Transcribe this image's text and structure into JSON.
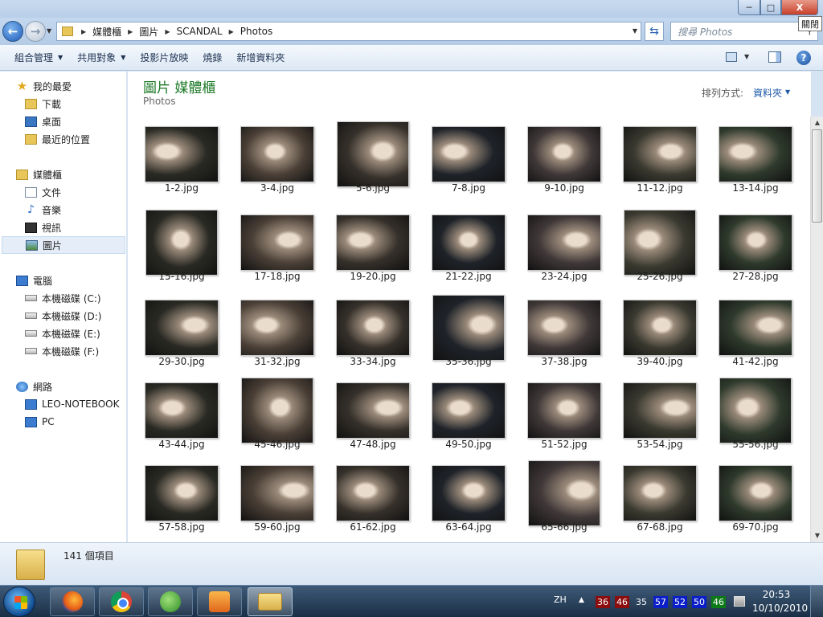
{
  "window": {
    "close_tooltip": "關閉",
    "caption": {
      "minimize": "─",
      "maximize": "□",
      "close": "X"
    }
  },
  "address": {
    "crumbs": [
      "媒體櫃",
      "圖片",
      "SCANDAL",
      "Photos"
    ],
    "search_placeholder": "搜尋 Photos"
  },
  "toolbar": {
    "organize": "組合管理",
    "share_with": "共用對象",
    "slideshow": "投影片放映",
    "burn": "燒錄",
    "new_folder": "新增資料夾"
  },
  "navpane": {
    "favorites": {
      "label": "我的最愛",
      "items": [
        {
          "label": "下載",
          "icon": "download-folder-icon"
        },
        {
          "label": "桌面",
          "icon": "desktop-icon"
        },
        {
          "label": "最近的位置",
          "icon": "recent-places-icon"
        }
      ]
    },
    "libraries": {
      "label": "媒體櫃",
      "items": [
        {
          "label": "文件",
          "icon": "documents-icon"
        },
        {
          "label": "音樂",
          "icon": "music-icon"
        },
        {
          "label": "視訊",
          "icon": "video-icon"
        },
        {
          "label": "圖片",
          "icon": "pictures-icon",
          "selected": true
        }
      ]
    },
    "computer": {
      "label": "電腦",
      "items": [
        {
          "label": "本機磁碟 (C:)",
          "icon": "drive-icon"
        },
        {
          "label": "本機磁碟 (D:)",
          "icon": "drive-icon"
        },
        {
          "label": "本機磁碟 (E:)",
          "icon": "drive-icon"
        },
        {
          "label": "本機磁碟 (F:)",
          "icon": "drive-icon"
        }
      ]
    },
    "network": {
      "label": "網路",
      "items": [
        {
          "label": "LEO-NOTEBOOK",
          "icon": "network-computer-icon"
        },
        {
          "label": "PC",
          "icon": "network-computer-icon"
        }
      ]
    }
  },
  "content": {
    "library_title": "圖片 媒體櫃",
    "library_subtitle": "Photos",
    "arrange_label": "排列方式:",
    "arrange_value": "資料夾",
    "files": [
      "1-2.jpg",
      "3-4.jpg",
      "5-6.jpg",
      "7-8.jpg",
      "9-10.jpg",
      "11-12.jpg",
      "13-14.jpg",
      "15-16.jpg",
      "17-18.jpg",
      "19-20.jpg",
      "21-22.jpg",
      "23-24.jpg",
      "25-26.jpg",
      "27-28.jpg",
      "29-30.jpg",
      "31-32.jpg",
      "33-34.jpg",
      "35-36.jpg",
      "37-38.jpg",
      "39-40.jpg",
      "41-42.jpg",
      "43-44.jpg",
      "45-46.jpg",
      "47-48.jpg",
      "49-50.jpg",
      "51-52.jpg",
      "53-54.jpg",
      "55-56.jpg",
      "57-58.jpg",
      "59-60.jpg",
      "61-62.jpg",
      "63-64.jpg",
      "65-66.jpg",
      "67-68.jpg",
      "69-70.jpg"
    ]
  },
  "details": {
    "item_count": "141 個項目"
  },
  "taskbar": {
    "lang": "ZH",
    "tray_temps": [
      {
        "value": "36",
        "color": "#8b0d0d"
      },
      {
        "value": "46",
        "color": "#8b0d0d"
      },
      {
        "value": "35",
        "color": "transparent"
      },
      {
        "value": "57",
        "color": "#0b1fc9"
      },
      {
        "value": "52",
        "color": "#0b1fc9"
      },
      {
        "value": "50",
        "color": "#0b1fc9"
      },
      {
        "value": "46",
        "color": "#0d7a18"
      }
    ],
    "time": "20:53",
    "date": "10/10/2010"
  },
  "colors": {
    "library_title": "#1e7a28",
    "link_blue": "#1e5aa8",
    "selected_nav": "#e4edf8"
  }
}
